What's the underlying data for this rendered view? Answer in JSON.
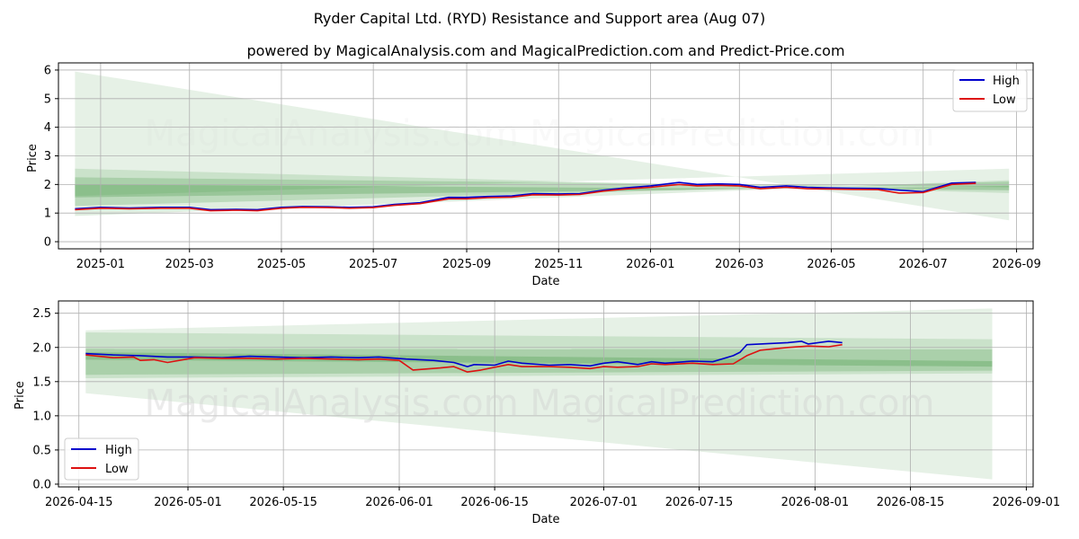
{
  "title": "Ryder Capital Ltd. (RYD) Resistance and Support area (Aug 07)",
  "subtitle": "powered by MagicalAnalysis.com and MagicalPrediction.com and Predict-Price.com",
  "watermark": "MagicalAnalysis.com    MagicalPrediction.com",
  "colors": {
    "high": "#0000cc",
    "low": "#dd1111",
    "band": "#2e8b2e",
    "grid": "#b0b0b0"
  },
  "chart_data": [
    {
      "type": "line",
      "xlabel": "Date",
      "ylabel": "Price",
      "ylim": [
        -0.25,
        6.25
      ],
      "xlim": [
        "2024-12-04",
        "2026-09-12"
      ],
      "x_ticks": [
        "2025-01",
        "2025-03",
        "2025-05",
        "2025-07",
        "2025-09",
        "2025-11",
        "2026-01",
        "2026-03",
        "2026-05",
        "2026-07",
        "2026-09"
      ],
      "x_tick_dates": [
        "2025-01-01",
        "2025-03-01",
        "2025-05-01",
        "2025-07-01",
        "2025-09-01",
        "2025-11-01",
        "2026-01-01",
        "2026-03-01",
        "2026-05-01",
        "2026-07-01",
        "2026-09-01"
      ],
      "y_ticks": [
        "0",
        "1",
        "2",
        "3",
        "4",
        "5",
        "6"
      ],
      "y_tick_values": [
        0,
        1,
        2,
        3,
        4,
        5,
        6
      ],
      "grid": true,
      "legend": "top-right",
      "bands": [
        {
          "x": [
            "2024-12-15",
            "2026-08-27"
          ],
          "upper": [
            5.95,
            0.75
          ],
          "lower": [
            1.6,
            2.55
          ],
          "opacity": 0.12
        },
        {
          "x": [
            "2024-12-15",
            "2026-08-27"
          ],
          "upper": [
            2.55,
            1.7
          ],
          "lower": [
            0.9,
            2.15
          ],
          "opacity": 0.15
        },
        {
          "x": [
            "2024-12-15",
            "2026-08-27"
          ],
          "upper": [
            2.25,
            1.9
          ],
          "lower": [
            1.25,
            2.1
          ],
          "opacity": 0.2
        },
        {
          "x": [
            "2024-12-15",
            "2026-08-27"
          ],
          "upper": [
            2.0,
            1.8
          ],
          "lower": [
            1.55,
            1.95
          ],
          "opacity": 0.25
        }
      ],
      "series": [
        {
          "name": "High",
          "x": [
            "2024-12-15",
            "2025-01-01",
            "2025-01-20",
            "2025-02-10",
            "2025-03-01",
            "2025-03-15",
            "2025-04-01",
            "2025-04-15",
            "2025-05-01",
            "2025-05-15",
            "2025-06-01",
            "2025-06-15",
            "2025-07-01",
            "2025-07-15",
            "2025-08-01",
            "2025-08-20",
            "2025-09-01",
            "2025-09-15",
            "2025-10-01",
            "2025-10-15",
            "2025-11-01",
            "2025-11-15",
            "2025-12-01",
            "2025-12-15",
            "2026-01-01",
            "2026-01-20",
            "2026-02-01",
            "2026-02-15",
            "2026-03-01",
            "2026-03-15",
            "2026-04-01",
            "2026-04-15",
            "2026-05-01",
            "2026-05-15",
            "2026-06-01",
            "2026-06-15",
            "2026-07-01",
            "2026-07-20",
            "2026-08-05"
          ],
          "values": [
            1.15,
            1.2,
            1.18,
            1.2,
            1.2,
            1.12,
            1.13,
            1.12,
            1.2,
            1.23,
            1.22,
            1.2,
            1.22,
            1.3,
            1.36,
            1.55,
            1.55,
            1.58,
            1.6,
            1.68,
            1.67,
            1.68,
            1.8,
            1.88,
            1.95,
            2.07,
            2.0,
            2.02,
            2.0,
            1.9,
            1.95,
            1.9,
            1.88,
            1.87,
            1.86,
            1.8,
            1.75,
            2.05,
            2.07
          ]
        },
        {
          "name": "Low",
          "x": [
            "2024-12-15",
            "2025-01-01",
            "2025-01-20",
            "2025-02-10",
            "2025-03-01",
            "2025-03-15",
            "2025-04-01",
            "2025-04-15",
            "2025-05-01",
            "2025-05-15",
            "2025-06-01",
            "2025-06-15",
            "2025-07-01",
            "2025-07-15",
            "2025-08-01",
            "2025-08-20",
            "2025-09-01",
            "2025-09-15",
            "2025-10-01",
            "2025-10-15",
            "2025-11-01",
            "2025-11-15",
            "2025-12-01",
            "2025-12-15",
            "2026-01-01",
            "2026-01-20",
            "2026-02-01",
            "2026-02-15",
            "2026-03-01",
            "2026-03-15",
            "2026-04-01",
            "2026-04-15",
            "2026-05-01",
            "2026-05-15",
            "2026-06-01",
            "2026-06-15",
            "2026-07-01",
            "2026-07-20",
            "2026-08-05"
          ],
          "values": [
            1.12,
            1.17,
            1.15,
            1.17,
            1.17,
            1.08,
            1.1,
            1.08,
            1.17,
            1.2,
            1.19,
            1.17,
            1.19,
            1.27,
            1.33,
            1.5,
            1.5,
            1.54,
            1.56,
            1.64,
            1.63,
            1.65,
            1.77,
            1.84,
            1.9,
            2.0,
            1.95,
            1.97,
            1.95,
            1.85,
            1.9,
            1.85,
            1.84,
            1.83,
            1.82,
            1.7,
            1.72,
            2.0,
            2.04
          ]
        }
      ]
    },
    {
      "type": "line",
      "xlabel": "Date",
      "ylabel": "Price",
      "ylim": [
        -0.04,
        2.68
      ],
      "xlim": [
        "2026-04-12",
        "2026-09-02"
      ],
      "x_ticks": [
        "2026-04-15",
        "2026-05-01",
        "2026-05-15",
        "2026-06-01",
        "2026-06-15",
        "2026-07-01",
        "2026-07-15",
        "2026-08-01",
        "2026-08-15",
        "2026-09-01"
      ],
      "x_tick_dates": [
        "2026-04-15",
        "2026-05-01",
        "2026-05-15",
        "2026-06-01",
        "2026-06-15",
        "2026-07-01",
        "2026-07-15",
        "2026-08-01",
        "2026-08-15",
        "2026-09-01"
      ],
      "y_ticks": [
        "0.0",
        "0.5",
        "1.0",
        "1.5",
        "2.0",
        "2.5"
      ],
      "y_tick_values": [
        0,
        0.5,
        1.0,
        1.5,
        2.0,
        2.5
      ],
      "grid": true,
      "legend": "bottom-left",
      "bands": [
        {
          "x": [
            "2026-04-16",
            "2026-08-27"
          ],
          "upper": [
            2.25,
            2.57
          ],
          "lower": [
            1.33,
            0.07
          ],
          "opacity": 0.12
        },
        {
          "x": [
            "2026-04-16",
            "2026-08-27"
          ],
          "upper": [
            2.22,
            2.12
          ],
          "lower": [
            1.55,
            1.62
          ],
          "opacity": 0.15
        },
        {
          "x": [
            "2026-04-16",
            "2026-08-27"
          ],
          "upper": [
            1.98,
            1.97
          ],
          "lower": [
            1.6,
            1.66
          ],
          "opacity": 0.2
        },
        {
          "x": [
            "2026-04-16",
            "2026-08-27"
          ],
          "upper": [
            1.93,
            1.8
          ],
          "lower": [
            1.82,
            1.72
          ],
          "opacity": 0.25
        }
      ],
      "series": [
        {
          "name": "High",
          "x": [
            "2026-04-16",
            "2026-04-20",
            "2026-04-24",
            "2026-04-28",
            "2026-05-02",
            "2026-05-06",
            "2026-05-10",
            "2026-05-14",
            "2026-05-18",
            "2026-05-22",
            "2026-05-26",
            "2026-05-29",
            "2026-06-02",
            "2026-06-06",
            "2026-06-09",
            "2026-06-11",
            "2026-06-12",
            "2026-06-15",
            "2026-06-17",
            "2026-06-19",
            "2026-06-23",
            "2026-06-26",
            "2026-06-29",
            "2026-07-01",
            "2026-07-03",
            "2026-07-06",
            "2026-07-08",
            "2026-07-10",
            "2026-07-14",
            "2026-07-17",
            "2026-07-20",
            "2026-07-21",
            "2026-07-22",
            "2026-07-28",
            "2026-07-30",
            "2026-07-31",
            "2026-08-03",
            "2026-08-05"
          ],
          "values": [
            1.91,
            1.89,
            1.88,
            1.86,
            1.86,
            1.85,
            1.87,
            1.86,
            1.85,
            1.86,
            1.85,
            1.86,
            1.83,
            1.81,
            1.78,
            1.72,
            1.75,
            1.74,
            1.8,
            1.77,
            1.74,
            1.75,
            1.73,
            1.77,
            1.79,
            1.75,
            1.79,
            1.77,
            1.8,
            1.79,
            1.88,
            1.93,
            2.04,
            2.07,
            2.09,
            2.05,
            2.09,
            2.07
          ]
        },
        {
          "name": "Low",
          "x": [
            "2026-04-16",
            "2026-04-20",
            "2026-04-23",
            "2026-04-24",
            "2026-04-26",
            "2026-04-28",
            "2026-05-02",
            "2026-05-06",
            "2026-05-10",
            "2026-05-14",
            "2026-05-18",
            "2026-05-22",
            "2026-05-26",
            "2026-05-29",
            "2026-06-01",
            "2026-06-03",
            "2026-06-07",
            "2026-06-09",
            "2026-06-11",
            "2026-06-13",
            "2026-06-17",
            "2026-06-19",
            "2026-06-23",
            "2026-06-26",
            "2026-06-29",
            "2026-07-01",
            "2026-07-03",
            "2026-07-06",
            "2026-07-08",
            "2026-07-10",
            "2026-07-14",
            "2026-07-17",
            "2026-07-20",
            "2026-07-22",
            "2026-07-24",
            "2026-07-28",
            "2026-07-31",
            "2026-08-03",
            "2026-08-05"
          ],
          "values": [
            1.89,
            1.85,
            1.86,
            1.81,
            1.82,
            1.78,
            1.85,
            1.84,
            1.84,
            1.83,
            1.84,
            1.83,
            1.82,
            1.83,
            1.81,
            1.67,
            1.7,
            1.72,
            1.64,
            1.67,
            1.75,
            1.72,
            1.72,
            1.71,
            1.69,
            1.72,
            1.71,
            1.72,
            1.76,
            1.75,
            1.77,
            1.75,
            1.76,
            1.88,
            1.96,
            2.0,
            2.02,
            2.01,
            2.04
          ]
        }
      ]
    }
  ]
}
